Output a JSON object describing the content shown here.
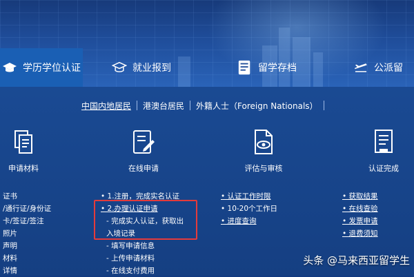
{
  "nav": {
    "items": [
      {
        "label": "学历学位认证",
        "icon": "graduation-cap-icon"
      },
      {
        "label": "就业报到",
        "icon": "mortarboard-icon"
      },
      {
        "label": "留学存档",
        "icon": "file-archive-icon"
      },
      {
        "label": "公派留",
        "icon": "airplane-icon"
      }
    ]
  },
  "subtabs": [
    "中国内地居民",
    "港澳台居民",
    "外籍人士（Foreign Nationals）"
  ],
  "steps": [
    {
      "label": "申请材料",
      "icon": "documents-icon"
    },
    {
      "label": "在线申请",
      "icon": "form-edit-icon"
    },
    {
      "label": "评估与审核",
      "icon": "file-view-icon"
    },
    {
      "label": "认证完成",
      "icon": "certificate-doc-icon"
    }
  ],
  "col1": [
    "证书",
    "/通行证/身份证",
    "卡/签证/签注",
    "照片",
    "声明",
    "材料",
    "详情"
  ],
  "col2": [
    "• 1.注册，完成实名认证",
    "• 2.办理认证申请",
    "- 完成实人认证，获取出",
    "入境记录",
    "- 填写申请信息",
    "- 上传申请材料",
    "- 在线支付费用"
  ],
  "col3": [
    "• 认证工作时限",
    "• 10-20个工作日",
    "• 进度查询"
  ],
  "col4": [
    "• 获取结果",
    "• 在线查验",
    "• 发票申请",
    "• 退费须知"
  ],
  "watermark": "头条 @马来西亚留学生",
  "colors": {
    "accent": "#1a5fb4",
    "highlight": "#e53b3b"
  }
}
